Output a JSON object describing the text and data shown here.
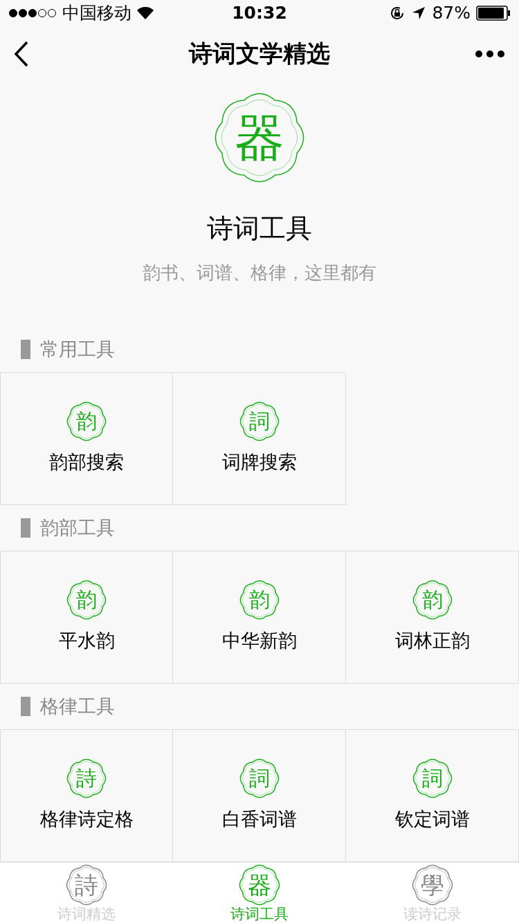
{
  "status_bar": {
    "carrier": "中国移动",
    "time": "10:32",
    "battery": "87%"
  },
  "nav_bar": {
    "title": "诗词文学精选"
  },
  "header": {
    "seal": "器",
    "title": "诗词工具",
    "subtitle": "韵书、词谱、格律，这里都有"
  },
  "sections": [
    {
      "title": "常用工具",
      "items": [
        {
          "seal": "韵",
          "label": "韵部搜索"
        },
        {
          "seal": "詞",
          "label": "词牌搜索"
        }
      ]
    },
    {
      "title": "韵部工具",
      "items": [
        {
          "seal": "韵",
          "label": "平水韵"
        },
        {
          "seal": "韵",
          "label": "中华新韵"
        },
        {
          "seal": "韵",
          "label": "词林正韵"
        }
      ]
    },
    {
      "title": "格律工具",
      "items": [
        {
          "seal": "詩",
          "label": "格律诗定格"
        },
        {
          "seal": "詞",
          "label": "白香词谱"
        },
        {
          "seal": "詞",
          "label": "钦定词谱"
        }
      ]
    }
  ],
  "tab_bar": [
    {
      "seal": "詩",
      "label": "诗词精选",
      "selected": false
    },
    {
      "seal": "器",
      "label": "诗词工具",
      "selected": true
    },
    {
      "seal": "學",
      "label": "读诗记录",
      "selected": false
    }
  ]
}
